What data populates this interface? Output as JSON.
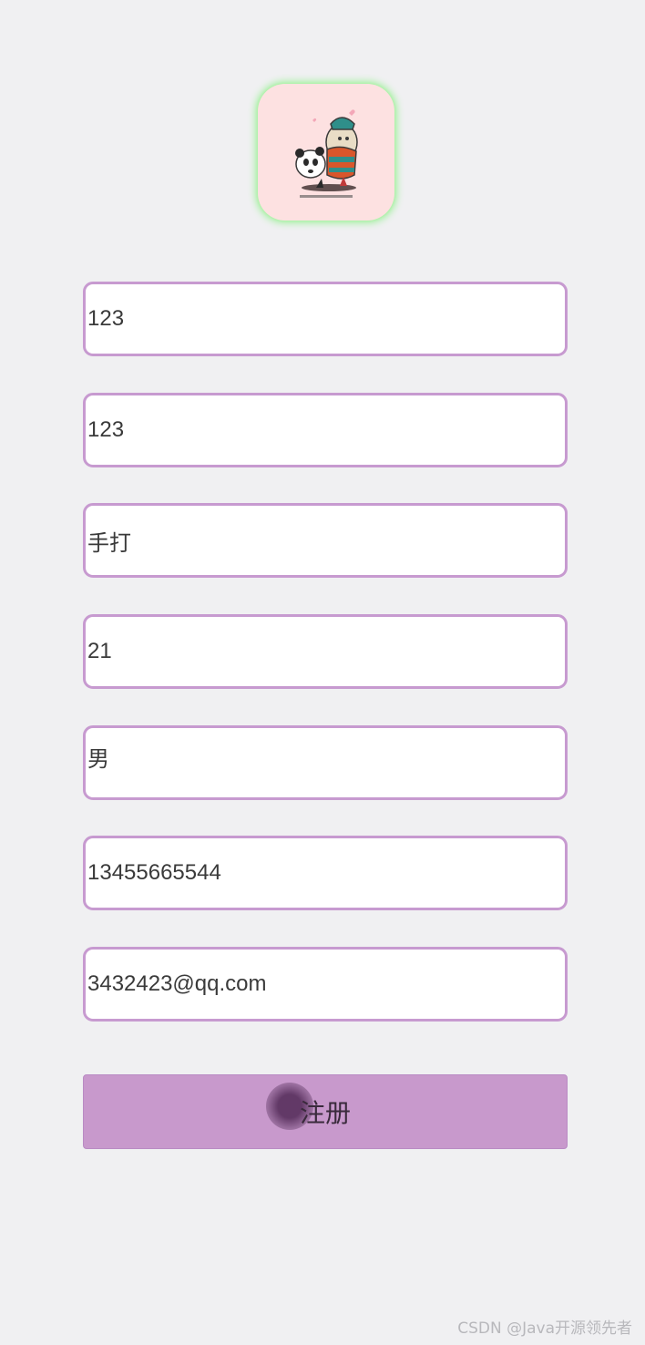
{
  "form": {
    "fields": [
      {
        "name": "username",
        "value": "123"
      },
      {
        "name": "password",
        "value": "123"
      },
      {
        "name": "nickname",
        "value": "手打"
      },
      {
        "name": "age",
        "value": "21"
      },
      {
        "name": "gender",
        "value": "男"
      },
      {
        "name": "phone",
        "value": "13455665544"
      },
      {
        "name": "email",
        "value": "3432423@qq.com"
      }
    ],
    "submit_label": "注册"
  },
  "avatar": {
    "icon": "cartoon-avatar-icon",
    "background": "#fde1e1",
    "glow": "#a6f0a2"
  },
  "colors": {
    "page_bg": "#f0f0f2",
    "field_border": "#c79ad0",
    "button_bg": "#c899cc"
  },
  "watermark": "CSDN @Java开源领先者"
}
